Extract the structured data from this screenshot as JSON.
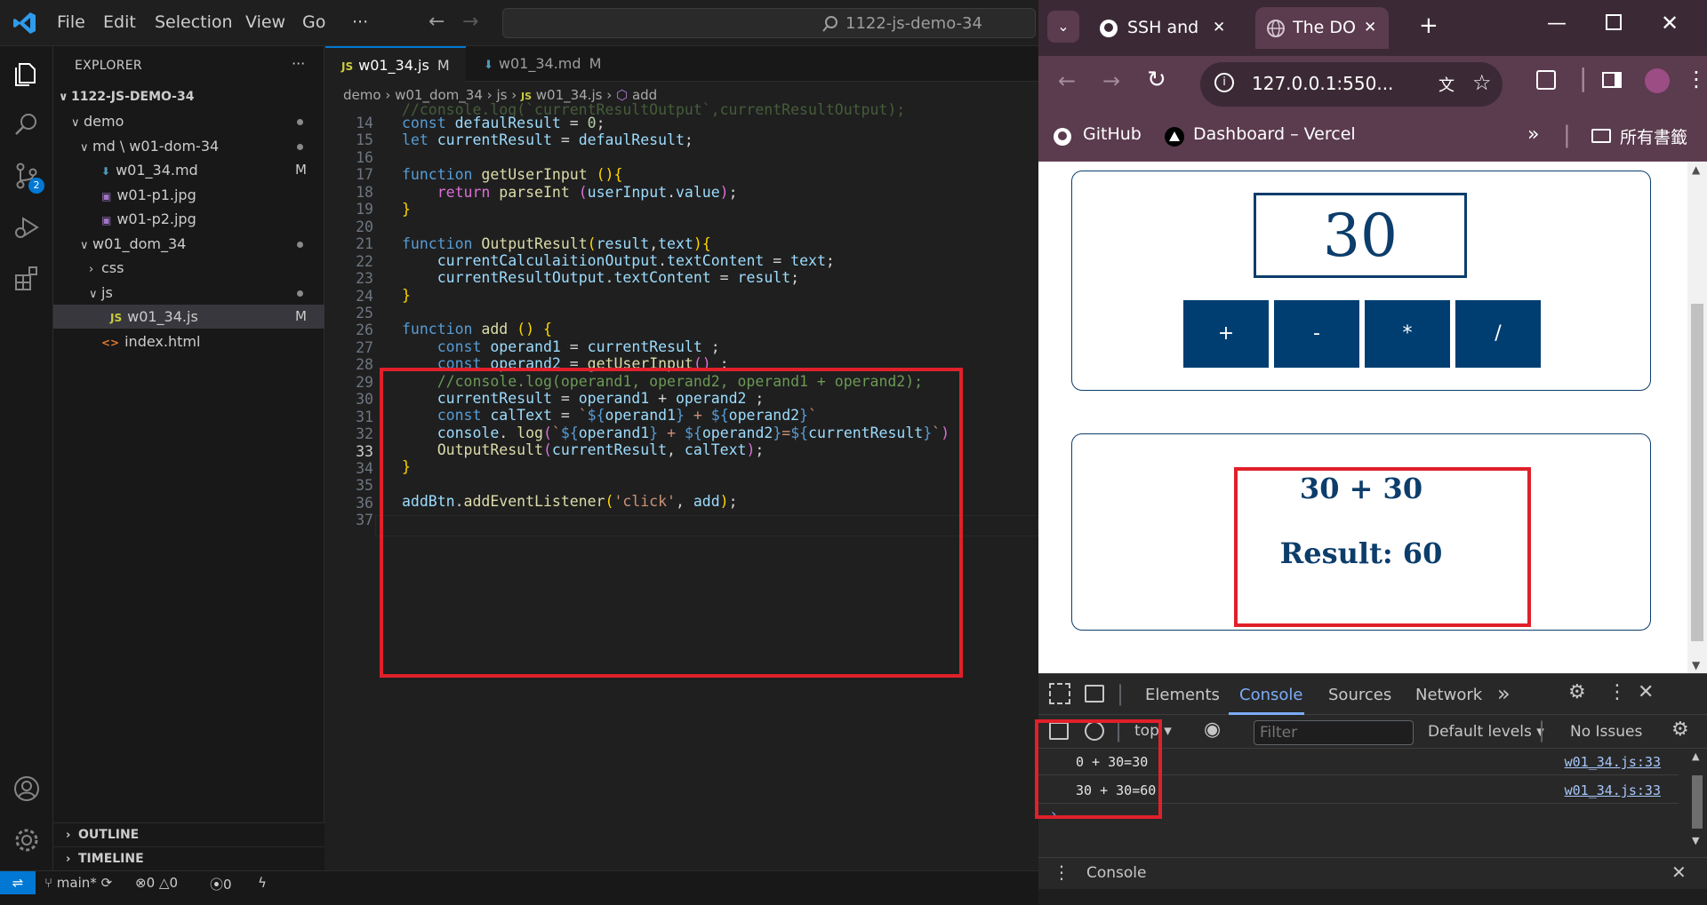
{
  "vscode": {
    "menu": [
      "File",
      "Edit",
      "Selection",
      "View",
      "Go",
      "···"
    ],
    "search_placeholder": "1122-js-demo-34",
    "explorer_title": "EXPLORER",
    "explorer_more": "···",
    "workspace": "1122-JS-DEMO-34",
    "tree": [
      {
        "label": "demo",
        "kind": "folder-open",
        "indent": 1,
        "dot": true
      },
      {
        "label": "md \\ w01-dom-34",
        "kind": "folder-open",
        "indent": 2,
        "dot": true
      },
      {
        "label": "w01_34.md",
        "kind": "md",
        "indent": 3,
        "badge": "M"
      },
      {
        "label": "w01-p1.jpg",
        "kind": "img",
        "indent": 3
      },
      {
        "label": "w01-p2.jpg",
        "kind": "img",
        "indent": 3
      },
      {
        "label": "w01_dom_34",
        "kind": "folder-open",
        "indent": 2,
        "dot": true
      },
      {
        "label": "css",
        "kind": "folder-closed",
        "indent": 3
      },
      {
        "label": "js",
        "kind": "folder-open",
        "indent": 3,
        "dot": true
      },
      {
        "label": "w01_34.js",
        "kind": "js",
        "indent": 4,
        "badge": "M",
        "selected": true
      },
      {
        "label": "index.html",
        "kind": "html",
        "indent": 3
      }
    ],
    "outline_label": "OUTLINE",
    "timeline_label": "TIMELINE",
    "tabs": [
      {
        "label": "w01_34.js",
        "modified": "M",
        "active": true,
        "type": "JS"
      },
      {
        "label": "w01_34.md",
        "modified": "M",
        "active": false,
        "type": "MD"
      }
    ],
    "breadcrumb": [
      "demo",
      "w01_dom_34",
      "js",
      "w01_34.js",
      "add"
    ],
    "line_numbers": [
      "14",
      "15",
      "16",
      "17",
      "18",
      "19",
      "20",
      "21",
      "22",
      "23",
      "24",
      "25",
      "26",
      "27",
      "28",
      "29",
      "30",
      "31",
      "32",
      "33",
      "34",
      "35",
      "36",
      "37"
    ],
    "current_line": "33",
    "status": {
      "branch": "main*",
      "errors": "0",
      "warnings": "0",
      "ports": "0"
    },
    "scm_badge": "2"
  },
  "chrome": {
    "tabs": [
      {
        "label": "SSH and",
        "active": false
      },
      {
        "label": "The DOM",
        "active": true
      }
    ],
    "url": "127.0.0.1:550...",
    "bookmarks": [
      "GitHub",
      "Dashboard – Vercel"
    ],
    "bookmarks_folder": "所有書籤",
    "calculator": {
      "display": "30",
      "operators": [
        "+",
        "-",
        "*",
        "/"
      ],
      "calc_text": "30 + 30",
      "result_text": "Result: 60"
    },
    "devtools": {
      "tabs": [
        "Elements",
        "Console",
        "Sources",
        "Network"
      ],
      "active_tab": "Console",
      "context": "top",
      "filter_placeholder": "Filter",
      "levels": "Default levels ▾",
      "issues": "No Issues",
      "logs": [
        {
          "text": "0 + 30=30",
          "source": "w01_34.js:33"
        },
        {
          "text": "30 + 30=60",
          "source": "w01_34.js:33"
        }
      ],
      "drawer_tab": "Console"
    }
  },
  "colors": {
    "accent": "#0078d4",
    "annotation_red": "#e0202a",
    "calc_navy": "#003e72"
  }
}
